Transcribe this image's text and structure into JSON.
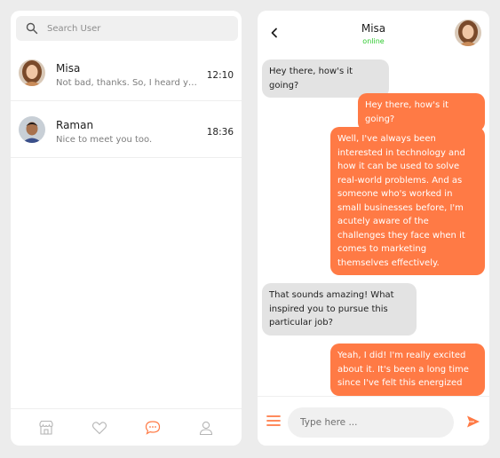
{
  "search": {
    "placeholder": "Search User"
  },
  "contacts": [
    {
      "name": "Misa",
      "preview": "Not bad, thanks. So, I heard you...",
      "time": "12:10"
    },
    {
      "name": "Raman",
      "preview": "Nice to meet you too.",
      "time": "18:36"
    }
  ],
  "bottom_nav": {
    "icons": [
      "store-icon",
      "heart-icon",
      "chat-bubble-icon",
      "user-icon"
    ],
    "active": "chat-bubble-icon"
  },
  "chat": {
    "contact_name": "Misa",
    "status": "online",
    "messages": [
      {
        "direction": "in",
        "text": "Hey there, how's it going?"
      },
      {
        "direction": "out",
        "text": "Hey there, how's it going?"
      },
      {
        "direction": "out",
        "text": "Well, I've always been interested in technology and how it can be used to solve real-world problems. And as someone who's worked in small businesses before, I'm acutely aware of the challenges they face when it comes to marketing themselves effectively."
      },
      {
        "direction": "in",
        "text": "That sounds amazing! What inspired you to pursue this particular job?"
      },
      {
        "direction": "out",
        "text": "Yeah, I did! I'm really excited about it. It's been a long time since I've felt this energized"
      }
    ],
    "input_placeholder": "Type here ..."
  },
  "colors": {
    "accent": "#ff7a45",
    "online": "#2ec92e",
    "incoming_bubble": "#e3e3e3",
    "background": "#ececec"
  }
}
